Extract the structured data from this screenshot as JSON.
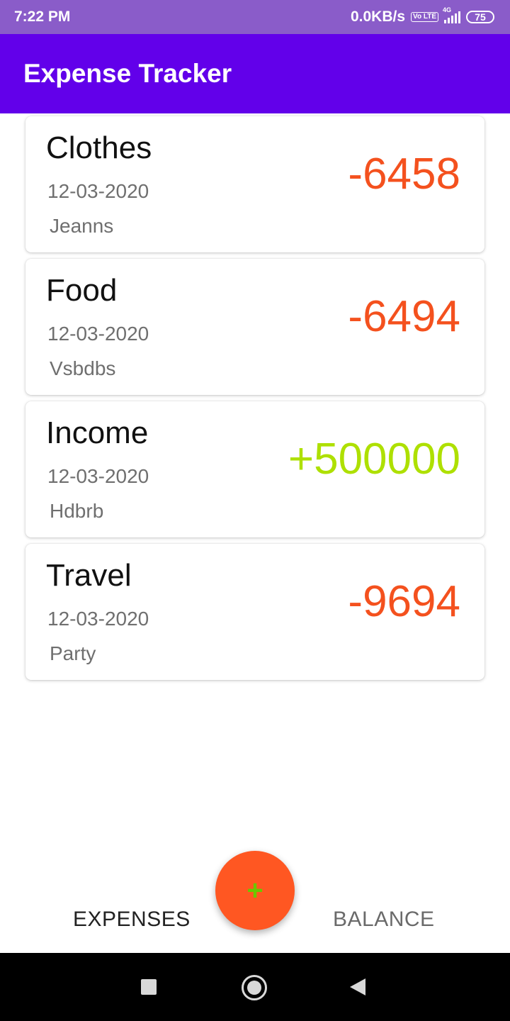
{
  "status_bar": {
    "time": "7:22 PM",
    "speed": "0.0KB/s",
    "volte": "Vo LTE",
    "network": "4G",
    "battery": "75"
  },
  "app_bar": {
    "title": "Expense Tracker"
  },
  "transactions": [
    {
      "category": "Clothes",
      "date": "12-03-2020",
      "note": "Jeanns",
      "amount": "-6458",
      "color": "#f4511e"
    },
    {
      "category": "Food",
      "date": "12-03-2020",
      "note": "Vsbdbs",
      "amount": "-6494",
      "color": "#f4511e"
    },
    {
      "category": "Income",
      "date": "12-03-2020",
      "note": "Hdbrb",
      "amount": "+500000",
      "color": "#aee000"
    },
    {
      "category": "Travel",
      "date": "12-03-2020",
      "note": "Party",
      "amount": "-9694",
      "color": "#f4511e"
    }
  ],
  "bottom_tabs": {
    "expenses": "EXPENSES",
    "balance": "BALANCE"
  },
  "fab": {
    "icon": "plus-icon",
    "label": "+"
  },
  "nav_bar": {
    "recents": "square-icon",
    "home": "circle-icon",
    "back": "triangle-back-icon"
  }
}
